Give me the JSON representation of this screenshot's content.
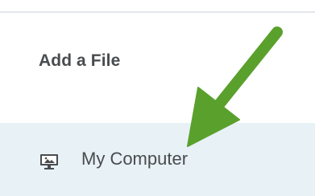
{
  "dialog": {
    "title": "Add a File"
  },
  "sources": [
    {
      "label": "My Computer",
      "icon": "desktop-computer-icon",
      "selected": true
    }
  ],
  "annotation": {
    "icon": "green-arrow-icon",
    "color": "#5aa02c"
  },
  "colors": {
    "selected_row_bg": "#e8f1f6",
    "text": "#494c4e",
    "divider": "#e3e6ea"
  }
}
